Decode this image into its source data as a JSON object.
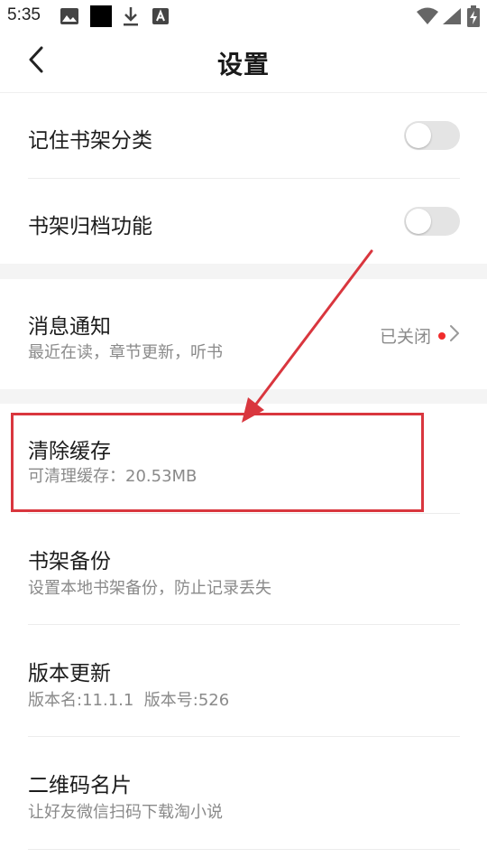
{
  "status_bar": {
    "time": "5:35",
    "icons": [
      "image-icon",
      "black-square-icon",
      "download-icon",
      "a-badge-icon",
      "wifi-icon",
      "signal-icon",
      "battery-charging-icon"
    ]
  },
  "header": {
    "title": "设置",
    "back_icon": "chevron-left-icon"
  },
  "settings": {
    "remember_shelf_category": {
      "title": "记住书架分类",
      "enabled": false
    },
    "shelf_archive": {
      "title": "书架归档功能",
      "enabled": false
    },
    "notifications": {
      "title": "消息通知",
      "subtitle": "最近在读，章节更新，听书",
      "status": "已关闭"
    },
    "clear_cache": {
      "title": "清除缓存",
      "subtitle": "可清理缓存：20.53MB"
    },
    "shelf_backup": {
      "title": "书架备份",
      "subtitle": "设置本地书架备份，防止记录丢失"
    },
    "version_update": {
      "title": "版本更新",
      "subtitle": "版本名:11.1.1  版本号:526"
    },
    "qr_card": {
      "title": "二维码名片",
      "subtitle": "让好友微信扫码下载淘小说"
    }
  },
  "colors": {
    "annotation_red": "#d9363e",
    "dot_red": "#f02b2b",
    "toggle_off": "#e4e4e4",
    "gap_bg": "#f4f4f4"
  }
}
